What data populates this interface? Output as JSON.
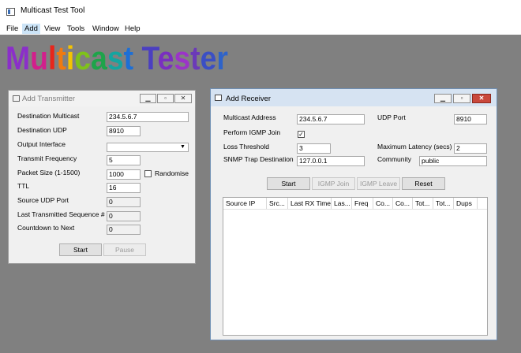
{
  "app": {
    "title": "Multicast Test Tool"
  },
  "menu": [
    "File",
    "Add",
    "View",
    "Tools",
    "Window",
    "Help"
  ],
  "banner": {
    "text": "Multicast Tester",
    "colors": [
      "#8b2fc9",
      "#d21f8c",
      "#e8261b",
      "#f07a10",
      "#f5c400",
      "#7fc21a",
      "#1ea44a",
      "#15a5a0",
      "#1d6fd6",
      "#4b3fc1",
      "#7a2fc0",
      "#9b34c8",
      "#6b3ab8",
      "#3b4fc4",
      "#2e63c9",
      "#6e3bbf"
    ]
  },
  "transmitter": {
    "title": "Add Transmitter",
    "labels": {
      "destination_multicast": "Destination Multicast",
      "destination_udp": "Destination UDP",
      "output_interface": "Output Interface",
      "transmit_frequency": "Transmit Frequency",
      "packet_size": "Packet Size (1-1500)",
      "randomise": "Randomise",
      "ttl": "TTL",
      "source_udp_port": "Source UDP Port",
      "last_seq": "Last Transmitted Sequence #",
      "countdown": "Countdown to Next"
    },
    "values": {
      "destination_multicast": "234.5.6.7",
      "destination_udp": "8910",
      "output_interface": "",
      "transmit_frequency": "5",
      "packet_size": "1000",
      "ttl": "16",
      "source_udp_port": "0",
      "last_seq": "0",
      "countdown": "0"
    },
    "buttons": {
      "start": "Start",
      "pause": "Pause"
    }
  },
  "receiver": {
    "title": "Add Receiver",
    "labels": {
      "multicast_address": "Multicast Address",
      "udp_port": "UDP Port",
      "perform_igmp_join": "Perform IGMP Join",
      "loss_threshold": "Loss Threshold",
      "max_latency": "Maximum  Latency (secs)",
      "snmp_trap": "SNMP Trap Destination",
      "community": "Community"
    },
    "values": {
      "multicast_address": "234.5.6.7",
      "udp_port": "8910",
      "perform_igmp_join": "✓",
      "loss_threshold": "3",
      "max_latency": "2",
      "snmp_trap": "127.0.0.1",
      "community": "public"
    },
    "buttons": {
      "start": "Start",
      "igmp_join": "IGMP Join",
      "igmp_leave": "IGMP Leave",
      "reset": "Reset"
    },
    "columns": [
      "Source IP",
      "Src...",
      "Last RX Time",
      "Las...",
      "Freq",
      "Co...",
      "Co...",
      "Tot...",
      "Tot...",
      "Dups"
    ]
  }
}
